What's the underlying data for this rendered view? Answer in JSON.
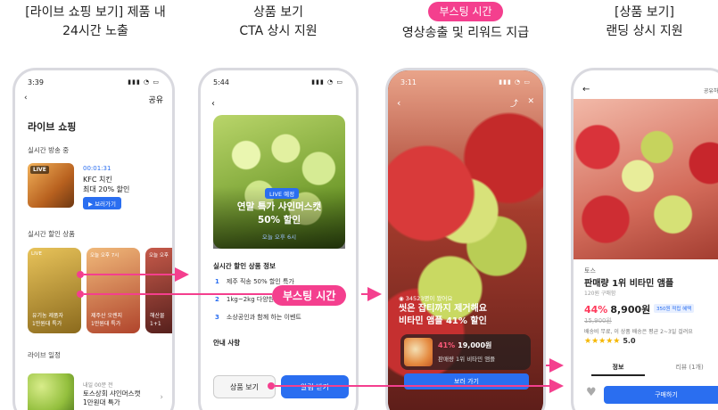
{
  "captions": {
    "c1": [
      "[라이브 쇼핑 보기] 제품 내",
      "24시간 노출"
    ],
    "c2": [
      "상품 보기",
      "CTA 상시 지원"
    ],
    "c3_badge": "부스팅 시간",
    "c3": [
      "영상송출 및 리워드 지급"
    ],
    "c4": [
      "[상품 보기]",
      "랜딩 상시 지원"
    ]
  },
  "phone1": {
    "time": "3:39",
    "share": "공유",
    "title": "라이브 쇼핑",
    "live_now": "실시간 방송 중",
    "live_tag": "LIVE",
    "timer": "00:01:31",
    "product": [
      "KFC 치킨",
      "최대 20% 할인"
    ],
    "watch_btn": "보러가기",
    "deals": "실시간 할인 상품",
    "cards": [
      {
        "tag": "LIVE",
        "text": [
          "유기농 제품자",
          "1만원대 특가"
        ]
      },
      {
        "tag": "오늘 오후 7시",
        "text": [
          "제주산 오렌지",
          "1만원대 특가"
        ]
      },
      {
        "tag": "오늘 오후",
        "text": [
          "해산물",
          "1+1"
        ]
      }
    ],
    "schedule": "라이브 일정",
    "sched_time": "내일 00분 전",
    "sched_item": [
      "토스상회 샤인머스캣",
      "1만원대 특가"
    ]
  },
  "phone2": {
    "time": "5:44",
    "live": "LIVE 예정",
    "headline": [
      "연말 특가 샤인머스캣",
      "50% 할인"
    ],
    "when": "오늘 오후 6시",
    "section": "실시간 할인 상품 정보",
    "rows": [
      {
        "n": "1",
        "t": "제주 직송 50% 할인 특가"
      },
      {
        "n": "2",
        "t": "1kg~2kg 다양한 구성"
      },
      {
        "n": "3",
        "t": "소상공인과 함께 하는 이벤트"
      }
    ],
    "guide": "안내 사항",
    "btn_view": "상품 보기",
    "btn_cta": "알림 받기"
  },
  "phone3": {
    "time": "3:11",
    "watching": "34523명이 봤어요",
    "headline": [
      "씻은 잡티까지 제거해요",
      "비타민 앰플 41% 할인"
    ],
    "discount": "41%",
    "price": "19,000원",
    "pname": "판매량 1위 비타민 앰플",
    "btn": "보러 가기"
  },
  "phone4": {
    "share": "공유하기",
    "brand": "토스",
    "name": "판매량 1위 비타민 앰플",
    "option": "120원 구매함",
    "discount": "44%",
    "price": "8,900원",
    "point": "350원 적립 혜택",
    "old_price": "15,900원",
    "ship": "배송비 무료, 이 상품 배송은 평균 2~3일 걸려요",
    "rating": "5.0",
    "tab_info": "정보",
    "tab_review": "리뷰 (1개)",
    "buy": "구매하기"
  },
  "boost_label": "부스팅 시간",
  "colors": {
    "accent": "#2a6ef0",
    "boost": "#f43f8e"
  }
}
